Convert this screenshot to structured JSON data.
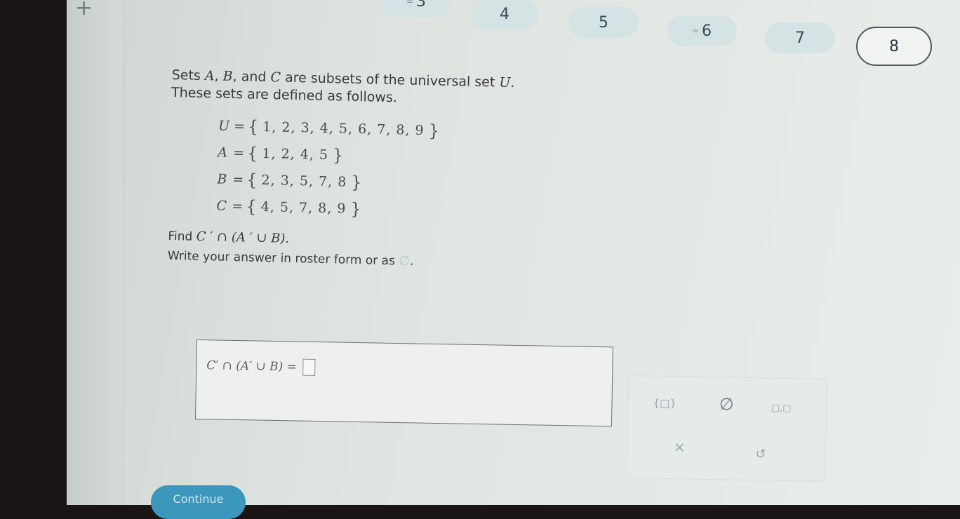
{
  "nav": {
    "plus_icon": "+",
    "tabs": [
      {
        "label": "3",
        "mark": "="
      },
      {
        "label": "4"
      },
      {
        "label": "5"
      },
      {
        "label": "6",
        "mark": "="
      },
      {
        "label": "7"
      },
      {
        "label": "8",
        "active": true
      }
    ]
  },
  "question": {
    "intro_part1": "Sets ",
    "set_a": "A",
    "comma1": ", ",
    "set_b": "B",
    "and": ", and ",
    "set_c": "C",
    "intro_part2": " are subsets of the universal set ",
    "set_u": "U",
    "period": ".",
    "intro_line2": "These sets are defined as follows.",
    "sets": [
      {
        "name": "U",
        "elements": "1, 2, 3, 4, 5, 6, 7, 8, 9"
      },
      {
        "name": "A",
        "elements": "1, 2, 4, 5"
      },
      {
        "name": "B",
        "elements": "2, 3, 5, 7, 8"
      },
      {
        "name": "C",
        "elements": "4, 5, 7, 8, 9"
      }
    ],
    "find_label": "Find ",
    "find_expression": "C ′ ∩ (A ′ ∪ B).",
    "instruction": "Write your answer in roster form or as ",
    "instruction_end": "."
  },
  "answer": {
    "expression": "C′ ∩ (A′ ∪ B) ="
  },
  "keypad": {
    "braces_button": "{□}",
    "empty_set_button": "∅",
    "ellipsis_button": "□,□",
    "clear_button": "×",
    "undo_button": "↺"
  },
  "footer": {
    "continue_label": "Continue"
  }
}
